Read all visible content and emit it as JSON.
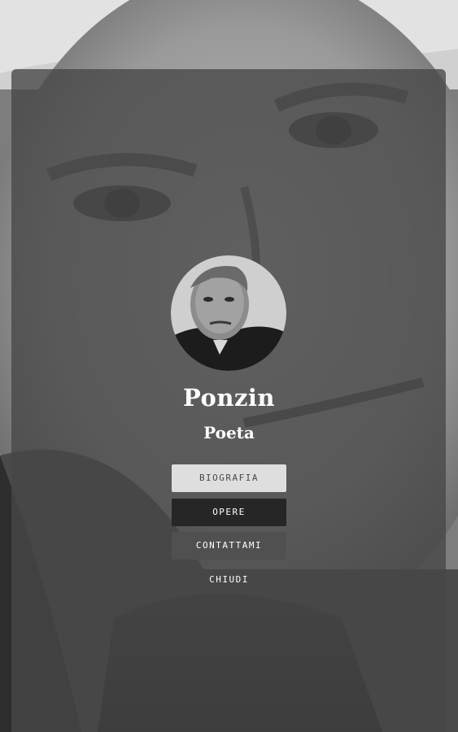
{
  "profile": {
    "name": "Ponzin",
    "role": "Poeta"
  },
  "menu": {
    "biografia": "BIOGRAFIA",
    "opere": "OPERE",
    "contattami": "CONTATTAMI",
    "chiudi": "CHIUDI"
  },
  "colors": {
    "card_overlay": "#464646",
    "active_button": "#dedede",
    "dark_button": "#262626",
    "mid_button": "#505050",
    "text": "#ffffff"
  }
}
